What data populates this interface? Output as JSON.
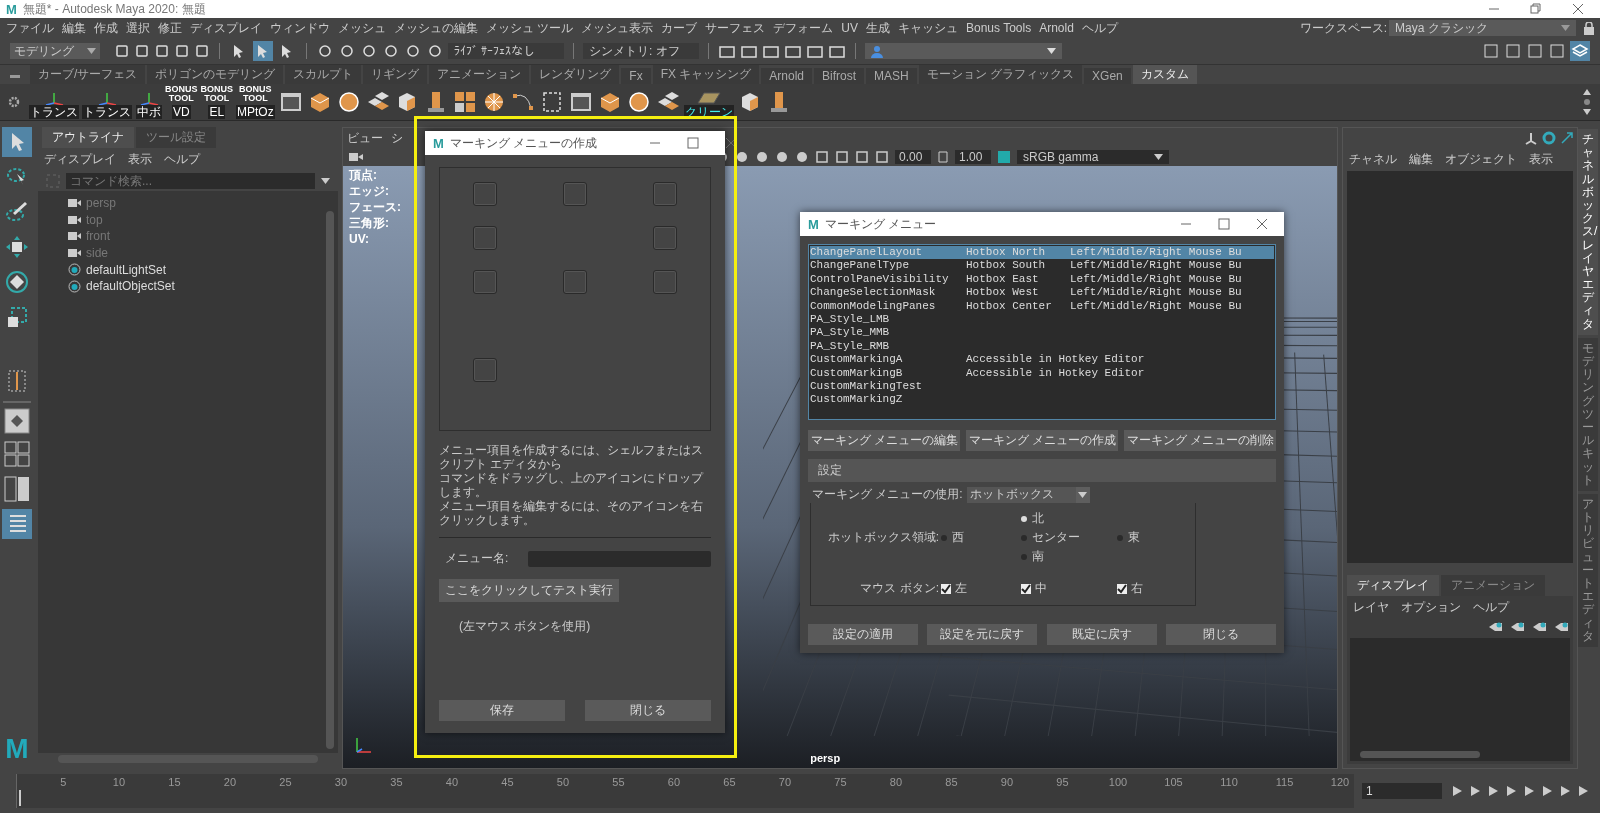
{
  "window": {
    "logo": "M",
    "title": "無題* - Autodesk Maya 2020: 無題"
  },
  "toolbox": {
    "logo": "M"
  },
  "menu_bar": [
    "ファイル",
    "編集",
    "作成",
    "選択",
    "修正",
    "ディスプレイ",
    "ウィンドウ",
    "メッシュ",
    "メッシュの編集",
    "メッシュ ツール",
    "メッシュ表示",
    "カーブ",
    "サーフェス",
    "デフォーム",
    "UV",
    "生成",
    "キャッシュ",
    "Bonus Tools",
    "Arnold",
    "ヘルプ"
  ],
  "status_line": {
    "mode": "モデリング",
    "live_surface": "ﾗｲﾌﾞ ｻｰﾌｪｽなし",
    "symmetry": "シンメトリ: オフ",
    "workspace_label": "ワークスペース:",
    "workspace": "Maya クラシック"
  },
  "shelf_tabs": [
    {
      "label": "カーブ/サーフェス",
      "selected": false
    },
    {
      "label": "ポリゴンのモデリング",
      "selected": false
    },
    {
      "label": "スカルプト",
      "selected": false
    },
    {
      "label": "リギング",
      "selected": false
    },
    {
      "label": "アニメーション",
      "selected": false
    },
    {
      "label": "レンダリング",
      "selected": false
    },
    {
      "label": "Fx",
      "selected": false
    },
    {
      "label": "FX キャッシング",
      "selected": false
    },
    {
      "label": "Arnold",
      "selected": false
    },
    {
      "label": "Bifrost",
      "selected": false
    },
    {
      "label": "MASH",
      "selected": false
    },
    {
      "label": "モーション グラフィックス",
      "selected": false
    },
    {
      "label": "XGen",
      "selected": false
    },
    {
      "label": "カスタム",
      "selected": true
    }
  ],
  "shelf_buttons": [
    {
      "kind": "axis",
      "label": "トランス"
    },
    {
      "kind": "axis",
      "label": "トランス"
    },
    {
      "kind": "axis",
      "label": "中ボ"
    },
    {
      "kind": "bonus",
      "lines": [
        "BONUS",
        "TOOL"
      ],
      "label": "VD"
    },
    {
      "kind": "bonus",
      "lines": [
        "BONUS",
        "TOOL"
      ],
      "label": "EL"
    },
    {
      "kind": "bonus",
      "lines": [
        "BONUS",
        "TOOL"
      ],
      "label": "MPtOz"
    },
    {
      "kind": "plain"
    },
    {
      "kind": "plain"
    },
    {
      "kind": "plain"
    },
    {
      "kind": "plain"
    },
    {
      "kind": "plain"
    },
    {
      "kind": "plain"
    },
    {
      "kind": "plain"
    },
    {
      "kind": "plain"
    },
    {
      "kind": "plain"
    },
    {
      "kind": "plain"
    },
    {
      "kind": "plain"
    },
    {
      "kind": "plain"
    },
    {
      "kind": "plain"
    },
    {
      "kind": "plain"
    },
    {
      "kind": "clean",
      "label": "クリーン"
    },
    {
      "kind": "plain"
    },
    {
      "kind": "plain"
    }
  ],
  "outliner": {
    "tabs": [
      {
        "label": "アウトライナ",
        "selected": true
      },
      {
        "label": "ツール設定",
        "selected": false
      }
    ],
    "menus": [
      "ディスプレイ",
      "表示",
      "ヘルプ"
    ],
    "search": {
      "placeholder": "コマンド検索..."
    },
    "items": [
      {
        "kind": "camera",
        "name": "persp",
        "hidden": true
      },
      {
        "kind": "camera",
        "name": "top",
        "hidden": true
      },
      {
        "kind": "camera",
        "name": "front",
        "hidden": true
      },
      {
        "kind": "camera",
        "name": "side",
        "hidden": true
      },
      {
        "kind": "set",
        "name": "defaultLightSet",
        "hidden": false
      },
      {
        "kind": "set",
        "name": "defaultObjectSet",
        "hidden": false
      }
    ]
  },
  "viewport": {
    "menus": [
      "ビュー",
      "シ"
    ],
    "hud": [
      "頂点:",
      "エッジ:",
      "フェース:",
      "三角形:",
      "UV:"
    ],
    "exposure": "0.00",
    "gamma": "1.00",
    "color_space": "sRGB gamma",
    "camera": "persp"
  },
  "create_dialog": {
    "logo": "M",
    "title": "マーキング メニューの作成",
    "instructions": [
      "メニュー項目を作成するには、シェルフまたはスクリプト エディタから",
      "コマンドをドラッグし、上のアイコンにドロップします。",
      "メニュー項目を編集するには、そのアイコンを右クリックします。"
    ],
    "menu_name_label": "メニュー名:",
    "test_button": "ここをクリックしてテスト実行",
    "test_note": "(左マウス ボタンを使用)",
    "buttons": [
      "保存",
      "閉じる"
    ]
  },
  "marking_dialog": {
    "logo": "M",
    "title": "マーキング メニュー",
    "rows": [
      {
        "name": "ChangePanelLayout",
        "location": "Hotbox North",
        "buttons": "Left/Middle/Right Mouse Bu",
        "selected": true
      },
      {
        "name": "ChangePanelType",
        "location": "Hotbox South",
        "buttons": "Left/Middle/Right Mouse Bu",
        "selected": false
      },
      {
        "name": "ControlPaneVisibility",
        "location": "Hotbox East",
        "buttons": "Left/Middle/Right Mouse Bu",
        "selected": false
      },
      {
        "name": "ChangeSelectionMask",
        "location": "Hotbox West",
        "buttons": "Left/Middle/Right Mouse Bu",
        "selected": false
      },
      {
        "name": "CommonModelingPanes",
        "location": "Hotbox Center",
        "buttons": "Left/Middle/Right Mouse Bu",
        "selected": false
      },
      {
        "name": "PA_Style_LMB",
        "location": "",
        "buttons": "",
        "selected": false
      },
      {
        "name": "PA_Style_MMB",
        "location": "",
        "buttons": "",
        "selected": false
      },
      {
        "name": "PA_Style_RMB",
        "location": "",
        "buttons": "",
        "selected": false
      },
      {
        "name": "CustomMarkingA",
        "location": "Accessible in Hotkey Editor",
        "buttons": "",
        "selected": false
      },
      {
        "name": "CustomMarkingB",
        "location": "Accessible in Hotkey Editor",
        "buttons": "",
        "selected": false
      },
      {
        "name": "CustomMarkingTest",
        "location": "",
        "buttons": "",
        "selected": false
      },
      {
        "name": "CustomMarkingZ",
        "location": "",
        "buttons": "",
        "selected": false
      }
    ],
    "actions": [
      "マーキング メニューの編集",
      "マーキング メニューの作成",
      "マーキング メニューの削除"
    ],
    "settings_header": "設定",
    "use_label": "マーキング メニューの使用:",
    "use_value": "ホットボックス",
    "region_label": "ホットボックス領域:",
    "regions": [
      {
        "kind": "north",
        "label": "北",
        "selected": true
      },
      {
        "kind": "west",
        "label": "西",
        "selected": false
      },
      {
        "kind": "center",
        "label": "センター",
        "selected": false
      },
      {
        "kind": "east",
        "label": "東",
        "selected": false
      },
      {
        "kind": "south",
        "label": "南",
        "selected": false
      }
    ],
    "mouse_label": "マウス ボタン:",
    "mouse_buttons": [
      {
        "label": "左",
        "checked": true
      },
      {
        "label": "中",
        "checked": true
      },
      {
        "label": "右",
        "checked": true
      }
    ],
    "footer": [
      "設定の適用",
      "設定を元に戻す",
      "既定に戻す",
      "閉じる"
    ]
  },
  "channel_box": {
    "menus": [
      "チャネル",
      "編集",
      "オブジェクト",
      "表示"
    ],
    "side_tabs": [
      {
        "label": "チャネルボックス/レイヤエディタ",
        "selected": true
      },
      {
        "label": "モデリングツールキット",
        "selected": false
      },
      {
        "label": "アトリビュートエディタ",
        "selected": false
      }
    ],
    "layer_tabs": [
      {
        "label": "ディスプレイ",
        "selected": true
      },
      {
        "label": "アニメーション",
        "selected": false
      }
    ],
    "layer_menus": [
      "レイヤ",
      "オプション",
      "ヘルプ"
    ]
  },
  "timeline": {
    "ticks": [
      "5",
      "10",
      "15",
      "20",
      "25",
      "30",
      "35",
      "40",
      "45",
      "50",
      "55",
      "60",
      "65",
      "70",
      "75",
      "80",
      "85",
      "90",
      "95",
      "100",
      "105",
      "110",
      "115",
      "120"
    ],
    "current_frame": "1",
    "level": 0
  }
}
